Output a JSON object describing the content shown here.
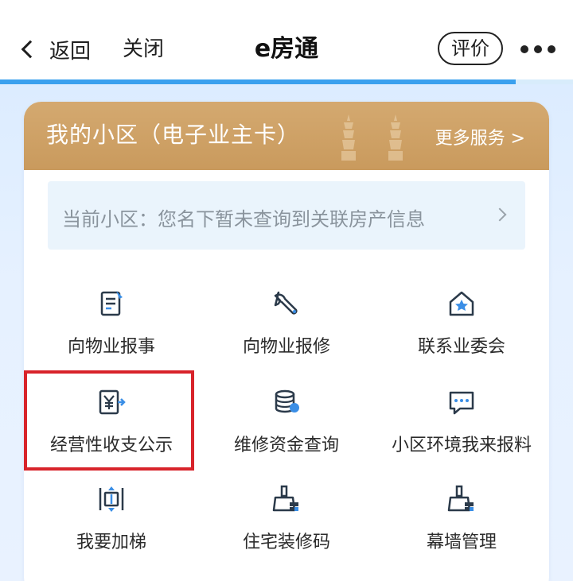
{
  "nav": {
    "back_label": "返回",
    "close_label": "关闭",
    "title": "e房通",
    "rate_label": "评价",
    "progress_percent": 90
  },
  "card": {
    "title": "我的小区（电子业主卡）",
    "more_label": "更多服务 >",
    "notice_text": "当前小区：您名下暂未查询到关联房产信息"
  },
  "services": [
    {
      "label": "向物业报事",
      "icon": "report-document-icon"
    },
    {
      "label": "向物业报修",
      "icon": "wrench-icon"
    },
    {
      "label": "联系业委会",
      "icon": "home-star-icon"
    },
    {
      "label": "经营性收支公示",
      "icon": "yuan-receipt-icon"
    },
    {
      "label": "维修资金查询",
      "icon": "coin-stack-icon"
    },
    {
      "label": "小区环境我来报料",
      "icon": "chat-bubble-icon"
    },
    {
      "label": "我要加梯",
      "icon": "elevator-icon"
    },
    {
      "label": "住宅装修码",
      "icon": "renovation-brush-icon"
    },
    {
      "label": "幕墙管理",
      "icon": "curtain-wall-brush-icon"
    }
  ],
  "colors": {
    "accent_blue": "#3a8ee6",
    "header_gold": "#d4a970",
    "highlight_red": "#d8232a"
  }
}
